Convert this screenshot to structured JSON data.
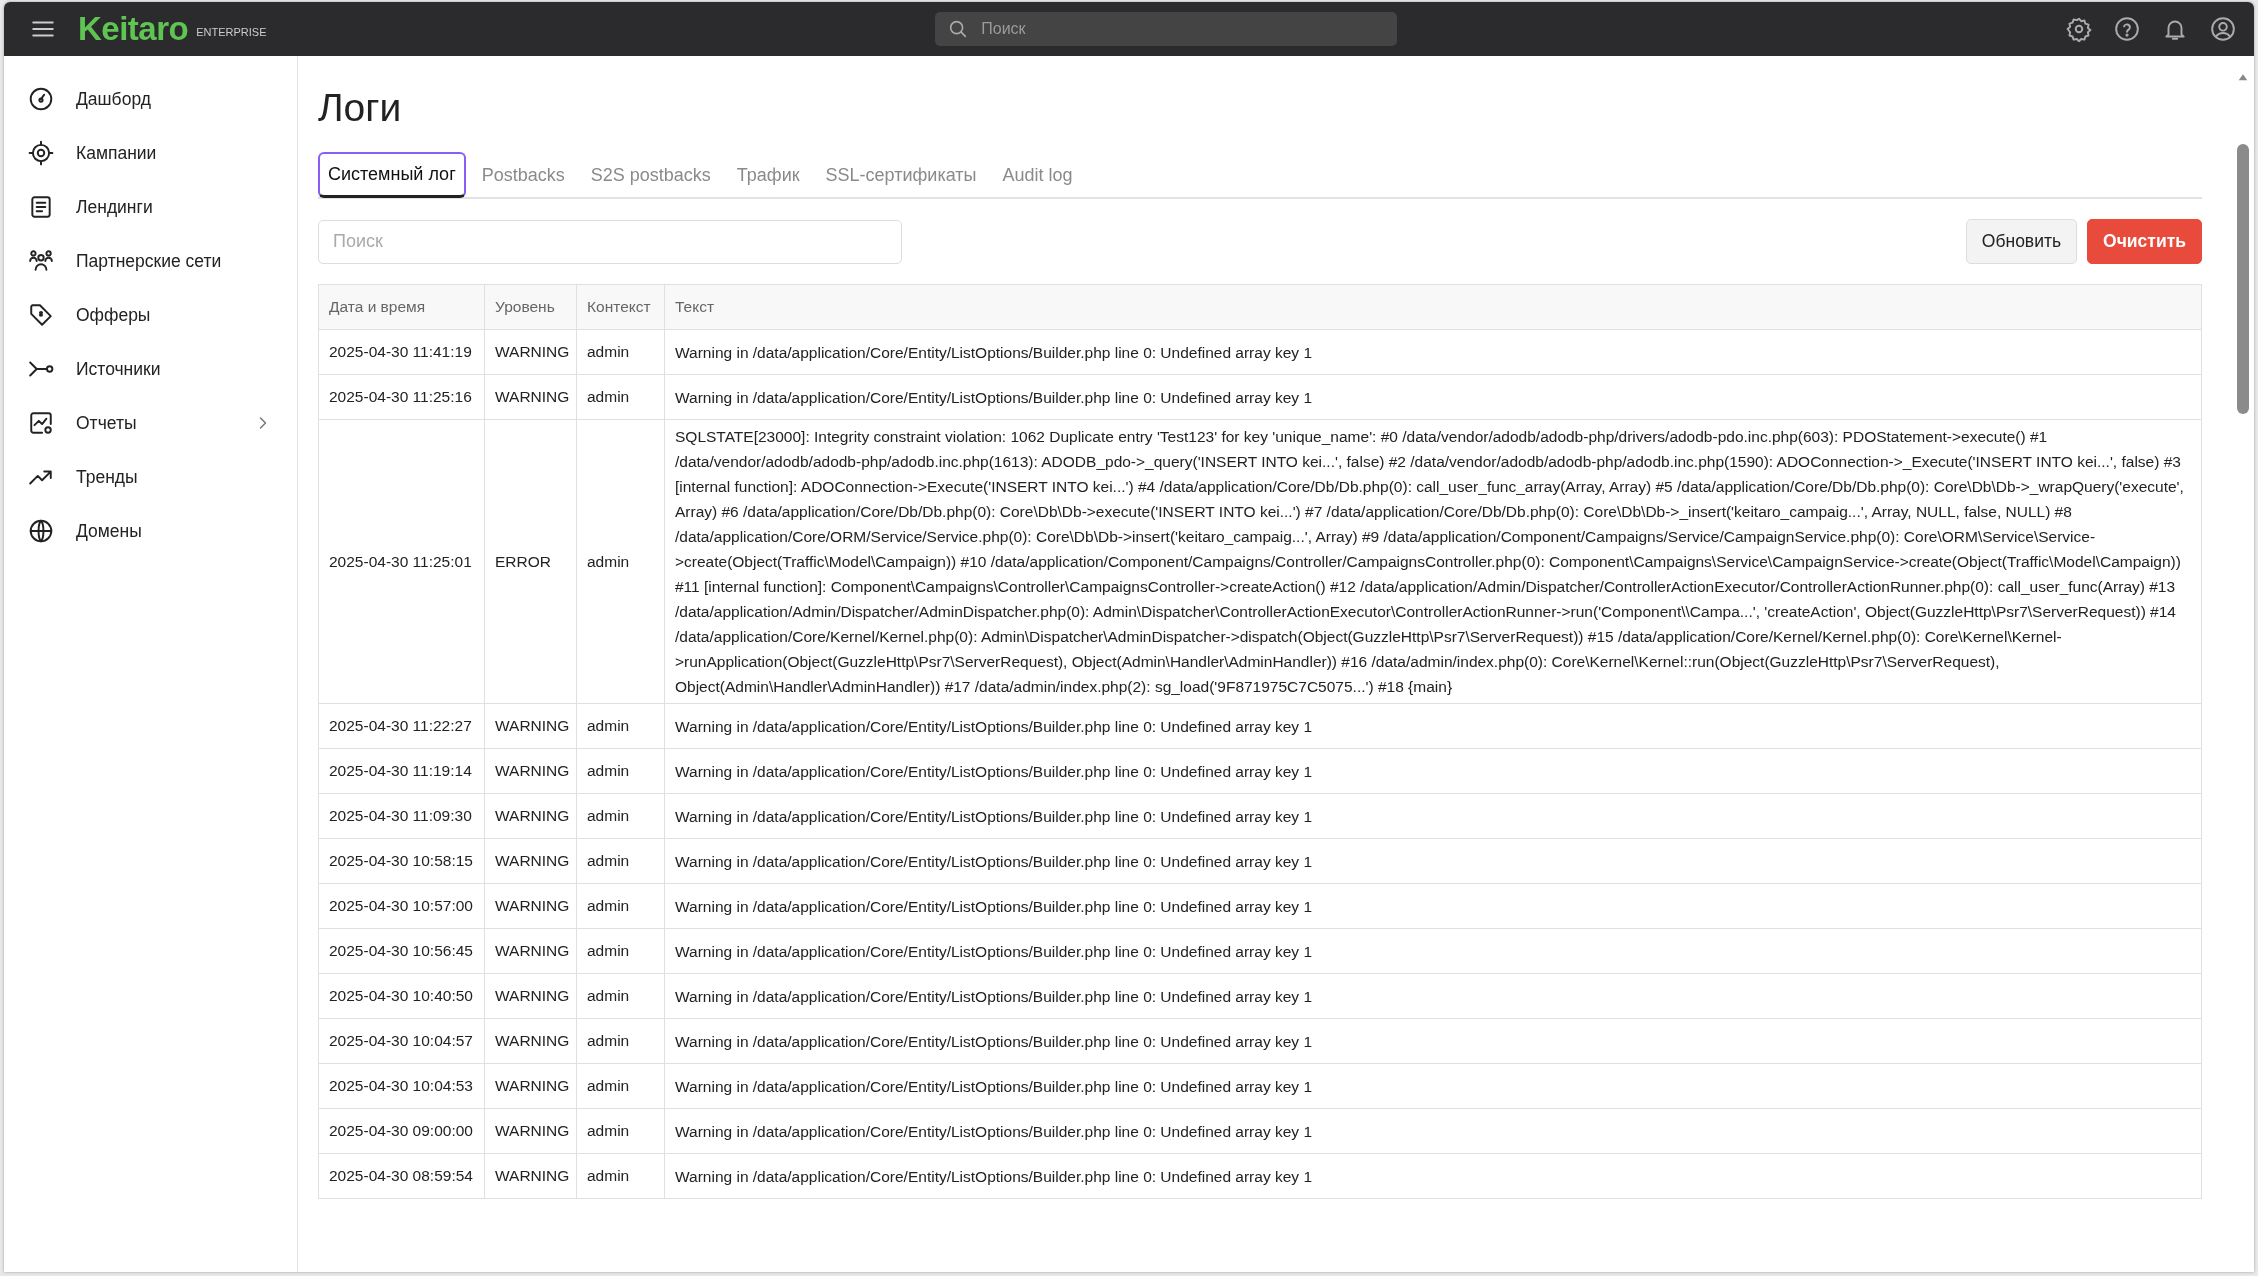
{
  "topbar": {
    "logo": "Keitaro",
    "edition": "ENTERPRISE",
    "search": {
      "placeholder": "Поиск"
    }
  },
  "sidebar": {
    "items": [
      {
        "label": "Дашборд",
        "has_submenu": false
      },
      {
        "label": "Кампании",
        "has_submenu": false
      },
      {
        "label": "Лендинги",
        "has_submenu": false
      },
      {
        "label": "Партнерские сети",
        "has_submenu": false
      },
      {
        "label": "Офферы",
        "has_submenu": false
      },
      {
        "label": "Источники",
        "has_submenu": false
      },
      {
        "label": "Отчеты",
        "has_submenu": true
      },
      {
        "label": "Тренды",
        "has_submenu": false
      },
      {
        "label": "Домены",
        "has_submenu": false
      }
    ]
  },
  "page": {
    "title": "Логи",
    "tabs": [
      {
        "label": "Системный лог",
        "selected": true
      },
      {
        "label": "Postbacks",
        "selected": false
      },
      {
        "label": "S2S postbacks",
        "selected": false
      },
      {
        "label": "Трафик",
        "selected": false
      },
      {
        "label": "SSL-сертификаты",
        "selected": false
      },
      {
        "label": "Audit log",
        "selected": false
      }
    ],
    "search": {
      "placeholder": "Поиск"
    },
    "buttons": [
      {
        "label": "Обновить",
        "kind": "secondary"
      },
      {
        "label": "Очистить",
        "kind": "danger"
      }
    ],
    "table": {
      "columns": [
        "Дата и время",
        "Уровень",
        "Контекст",
        "Текст"
      ],
      "rows": [
        [
          "2025-04-30 11:41:19",
          "WARNING",
          "admin",
          "Warning in /data/application/Core/Entity/ListOptions/Builder.php line 0: Undefined array key 1"
        ],
        [
          "2025-04-30 11:25:16",
          "WARNING",
          "admin",
          "Warning in /data/application/Core/Entity/ListOptions/Builder.php line 0: Undefined array key 1"
        ],
        [
          "2025-04-30 11:25:01",
          "ERROR",
          "admin",
          "SQLSTATE[23000]: Integrity constraint violation: 1062 Duplicate entry 'Test123' for key 'unique_name': #0 /data/vendor/adodb/adodb-php/drivers/adodb-pdo.inc.php(603): PDOStatement->execute() #1 /data/vendor/adodb/adodb-php/adodb.inc.php(1613): ADODB_pdo->_query('INSERT INTO kei...', false) #2 /data/vendor/adodb/adodb-php/adodb.inc.php(1590): ADOConnection->_Execute('INSERT INTO kei...', false) #3 [internal function]: ADOConnection->Execute('INSERT INTO kei...') #4 /data/application/Core/Db/Db.php(0): call_user_func_array(Array, Array) #5 /data/application/Core/Db/Db.php(0): Core\\Db\\Db->_wrapQuery('execute', Array) #6 /data/application/Core/Db/Db.php(0): Core\\Db\\Db->execute('INSERT INTO kei...') #7 /data/application/Core/Db/Db.php(0): Core\\Db\\Db->_insert('keitaro_campaig...', Array, NULL, false, NULL) #8 /data/application/Core/ORM/Service/Service.php(0): Core\\Db\\Db->insert('keitaro_campaig...', Array) #9 /data/application/Component/Campaigns/Service/CampaignService.php(0): Core\\ORM\\Service\\Service->create(Object(Traffic\\Model\\Campaign)) #10 /data/application/Component/Campaigns/Controller/CampaignsController.php(0): Component\\Campaigns\\Service\\CampaignService->create(Object(Traffic\\Model\\Campaign)) #11 [internal function]: Component\\Campaigns\\Controller\\CampaignsController->createAction() #12 /data/application/Admin/Dispatcher/ControllerActionExecutor/ControllerActionRunner.php(0): call_user_func(Array) #13 /data/application/Admin/Dispatcher/AdminDispatcher.php(0): Admin\\Dispatcher\\ControllerActionExecutor\\ControllerActionRunner->run('Component\\\\Campa...', 'createAction', Object(GuzzleHttp\\Psr7\\ServerRequest)) #14 /data/application/Core/Kernel/Kernel.php(0): Admin\\Dispatcher\\AdminDispatcher->dispatch(Object(GuzzleHttp\\Psr7\\ServerRequest)) #15 /data/application/Core/Kernel/Kernel.php(0): Core\\Kernel\\Kernel->runApplication(Object(GuzzleHttp\\Psr7\\ServerRequest), Object(Admin\\Handler\\AdminHandler)) #16 /data/admin/index.php(0): Core\\Kernel\\Kernel::run(Object(GuzzleHttp\\Psr7\\ServerRequest), Object(Admin\\Handler\\AdminHandler)) #17 /data/admin/index.php(2): sg_load('9F871975C7C5075...') #18 {main}"
        ],
        [
          "2025-04-30 11:22:27",
          "WARNING",
          "admin",
          "Warning in /data/application/Core/Entity/ListOptions/Builder.php line 0: Undefined array key 1"
        ],
        [
          "2025-04-30 11:19:14",
          "WARNING",
          "admin",
          "Warning in /data/application/Core/Entity/ListOptions/Builder.php line 0: Undefined array key 1"
        ],
        [
          "2025-04-30 11:09:30",
          "WARNING",
          "admin",
          "Warning in /data/application/Core/Entity/ListOptions/Builder.php line 0: Undefined array key 1"
        ],
        [
          "2025-04-30 10:58:15",
          "WARNING",
          "admin",
          "Warning in /data/application/Core/Entity/ListOptions/Builder.php line 0: Undefined array key 1"
        ],
        [
          "2025-04-30 10:57:00",
          "WARNING",
          "admin",
          "Warning in /data/application/Core/Entity/ListOptions/Builder.php line 0: Undefined array key 1"
        ],
        [
          "2025-04-30 10:56:45",
          "WARNING",
          "admin",
          "Warning in /data/application/Core/Entity/ListOptions/Builder.php line 0: Undefined array key 1"
        ],
        [
          "2025-04-30 10:40:50",
          "WARNING",
          "admin",
          "Warning in /data/application/Core/Entity/ListOptions/Builder.php line 0: Undefined array key 1"
        ],
        [
          "2025-04-30 10:04:57",
          "WARNING",
          "admin",
          "Warning in /data/application/Core/Entity/ListOptions/Builder.php line 0: Undefined array key 1"
        ],
        [
          "2025-04-30 10:04:53",
          "WARNING",
          "admin",
          "Warning in /data/application/Core/Entity/ListOptions/Builder.php line 0: Undefined array key 1"
        ],
        [
          "2025-04-30 09:00:00",
          "WARNING",
          "admin",
          "Warning in /data/application/Core/Entity/ListOptions/Builder.php line 0: Undefined array key 1"
        ],
        [
          "2025-04-30 08:59:54",
          "WARNING",
          "admin",
          "Warning in /data/application/Core/Entity/ListOptions/Builder.php line 0: Undefined array key 1"
        ]
      ]
    }
  }
}
